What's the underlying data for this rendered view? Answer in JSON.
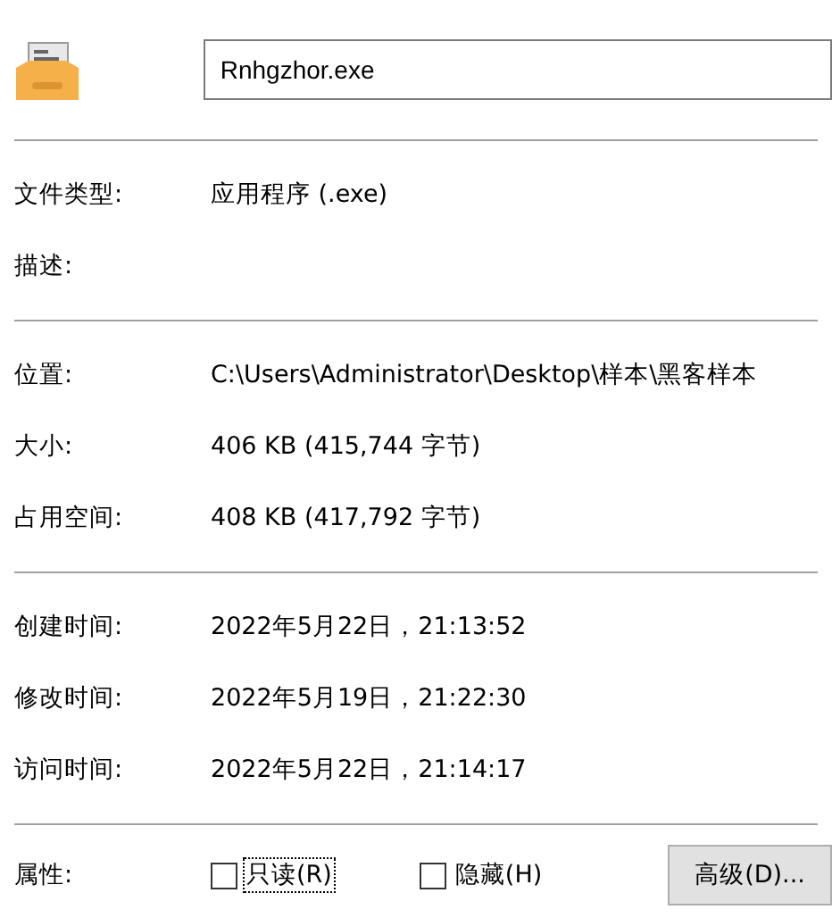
{
  "file_name": "Rnhgzhor.exe",
  "sections": [
    [
      {
        "label": "文件类型:",
        "value": "应用程序 (.exe)"
      },
      {
        "label": "描述:"
      }
    ],
    [
      {
        "label": "位置:",
        "value": "C:\\Users\\Administrator\\Desktop\\样本\\黑客样本"
      },
      {
        "label": "大小:",
        "value": "406 KB (415,744 字节)"
      },
      {
        "label": "占用空间:",
        "value": "408 KB (417,792 字节)"
      }
    ],
    [
      {
        "label": "创建时间:",
        "value": "2022年5月22日，21:13:52"
      },
      {
        "label": "修改时间:",
        "value": "2022年5月19日，21:22:30"
      },
      {
        "label": "访问时间:",
        "value": "2022年5月22日，21:14:17"
      }
    ]
  ],
  "attributes": {
    "label": "属性:",
    "options": [
      {
        "label": "只读(R)",
        "checked": false,
        "focused": true
      },
      {
        "label": "隐藏(H)",
        "checked": false,
        "focused": false
      }
    ],
    "advanced_button": "高级(D)..."
  }
}
